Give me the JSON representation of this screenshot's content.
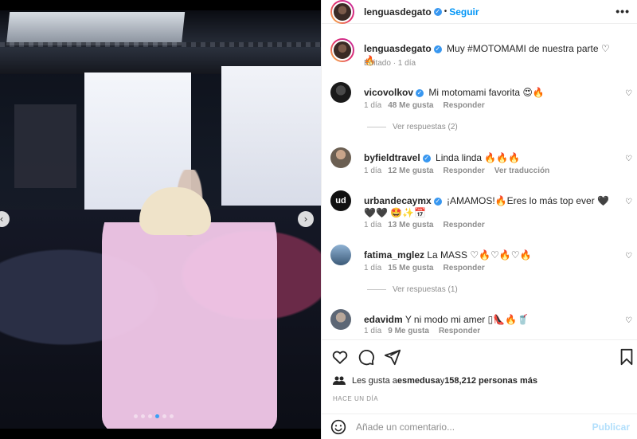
{
  "header": {
    "username": "lenguasdegato",
    "verified_mark": "✓",
    "follow_label": "Seguir",
    "more_label": "•••"
  },
  "caption": {
    "username": "lenguasdegato",
    "text": "Muy #MOTOMAMI de nuestra parte ♡🔥",
    "meta": "Editado · 1 día"
  },
  "comments": [
    {
      "user": "vicovolkov",
      "verified": true,
      "text": "Mi motomami favorita 😍🔥",
      "time": "1 día",
      "likes": "48 Me gusta",
      "reply": "Responder",
      "extra": "",
      "replies": "Ver respuestas (2)"
    },
    {
      "user": "byfieldtravel",
      "verified": true,
      "text": "Linda linda 🔥🔥🔥",
      "time": "1 día",
      "likes": "12 Me gusta",
      "reply": "Responder",
      "extra": "Ver traducción",
      "replies": ""
    },
    {
      "user": "urbandecaymx",
      "verified": true,
      "text": "¡AMAMOS!🔥Eres lo más top ever 🖤🖤🖤 🤩✨📅",
      "time": "1 día",
      "likes": "13 Me gusta",
      "reply": "Responder",
      "extra": "",
      "replies": ""
    },
    {
      "user": "fatima_mglez",
      "verified": false,
      "text": "La MASS ♡🔥♡🔥♡🔥",
      "time": "1 día",
      "likes": "15 Me gusta",
      "reply": "Responder",
      "extra": "",
      "replies": "Ver respuestas (1)"
    },
    {
      "user": "edavidm",
      "verified": false,
      "text": "Y ni modo mi amer ▯👠🔥🥤",
      "time": "1 día",
      "likes": "9 Me gusta",
      "reply": "Responder",
      "extra": "",
      "replies": ""
    }
  ],
  "likes": {
    "prefix": "Les gusta a ",
    "user": "esmedusa",
    "middle": " y ",
    "count": "158,212 personas más"
  },
  "time_label": "HACE UN DÍA",
  "add_comment": {
    "placeholder": "Añade un comentario...",
    "publish_label": "Publicar"
  },
  "carousel": {
    "prev": "‹",
    "next": "›",
    "dots": 6,
    "active_dot": 3
  },
  "colors": {
    "accent": "#0095f6",
    "verified": "#3897f0",
    "muted": "#8e8e8e",
    "publish_disabled": "#b2dffc"
  },
  "icons": [
    "heart-icon",
    "comment-icon",
    "share-icon",
    "bookmark-icon",
    "emoji-icon",
    "chevron-left-icon",
    "chevron-right-icon",
    "more-icon"
  ]
}
